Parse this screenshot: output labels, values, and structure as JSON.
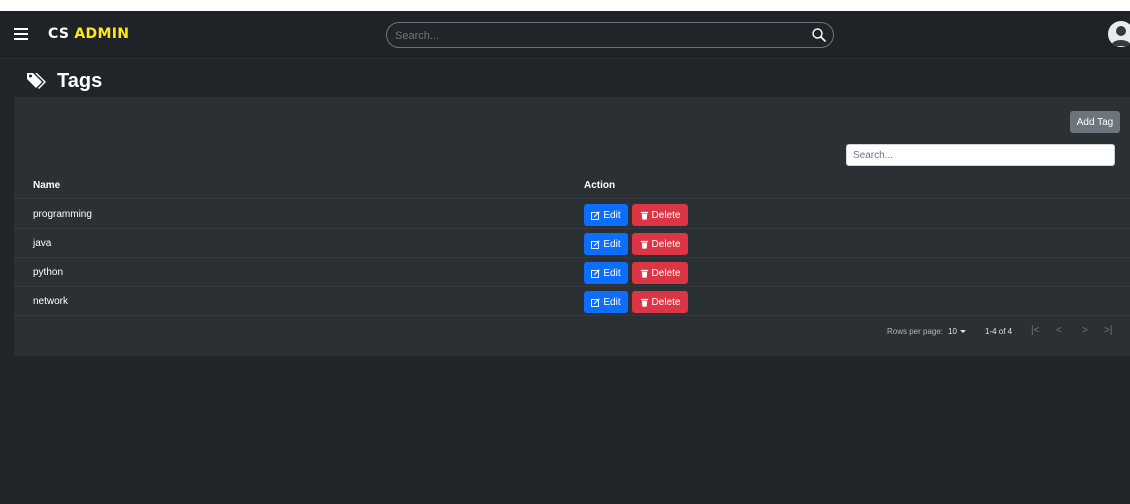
{
  "navbar": {
    "brand_part1": "CS",
    "brand_part2": "ADMIN",
    "search_placeholder": "Search...",
    "menu_icon": "hamburger-icon",
    "search_icon": "search-icon",
    "avatar_icon": "user-avatar-icon"
  },
  "page": {
    "title": "Tags",
    "title_icon": "tags-icon"
  },
  "card": {
    "add_button_label": "Add Tag",
    "search_placeholder": "Search...",
    "columns": [
      "Name",
      "Action"
    ],
    "rows": [
      {
        "name": "programming"
      },
      {
        "name": "java"
      },
      {
        "name": "python"
      },
      {
        "name": "network"
      }
    ],
    "edit_label": "Edit",
    "delete_label": "Delete",
    "pagination": {
      "rows_per_page_label": "Rows per page:",
      "rows_per_page_value": "10",
      "range": "1-4 of 4",
      "first": "|<",
      "prev": "<",
      "next": ">",
      "last": ">|"
    }
  },
  "colors": {
    "background": "#212529",
    "card": "#2b3035",
    "brand_accent": "#ffe81a",
    "edit_button": "#0d6efd",
    "delete_button": "#dc3545",
    "add_button": "#6c757d"
  }
}
